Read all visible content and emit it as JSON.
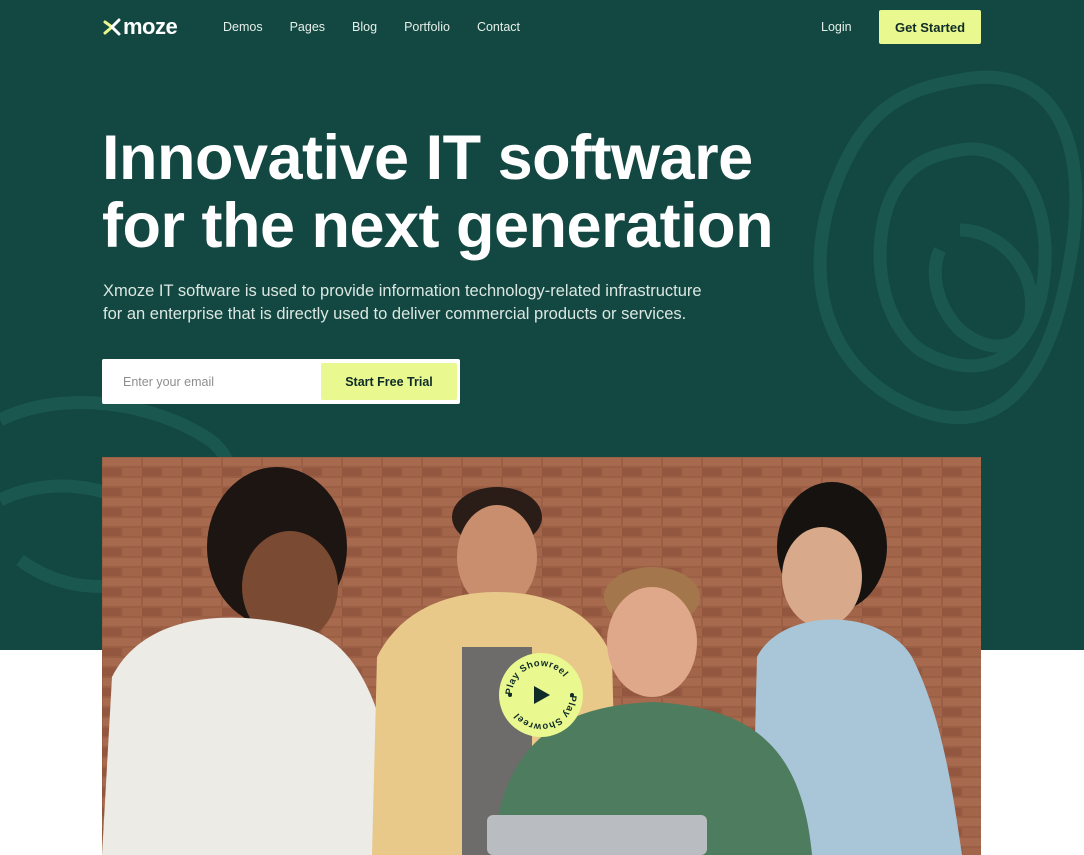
{
  "brand": {
    "name": "moze",
    "accent": "#e9f88f",
    "hero_bg": "#134741"
  },
  "nav": {
    "links": [
      "Demos",
      "Pages",
      "Blog",
      "Portfolio",
      "Contact"
    ],
    "login_label": "Login",
    "cta_label": "Get Started"
  },
  "hero": {
    "headline_line1": "Innovative IT software",
    "headline_line2": "for the next generation",
    "subtext_line1": "Xmoze IT software is used to provide information technology-related infrastructure",
    "subtext_line2": "for an enterprise that is directly used to deliver commercial products or services.",
    "email_placeholder": "Enter your email",
    "trial_label": "Start Free Trial"
  },
  "showreel": {
    "label": "Play Showreel",
    "icon": "play-icon"
  },
  "photo": {
    "description_icon": "team-photo"
  }
}
